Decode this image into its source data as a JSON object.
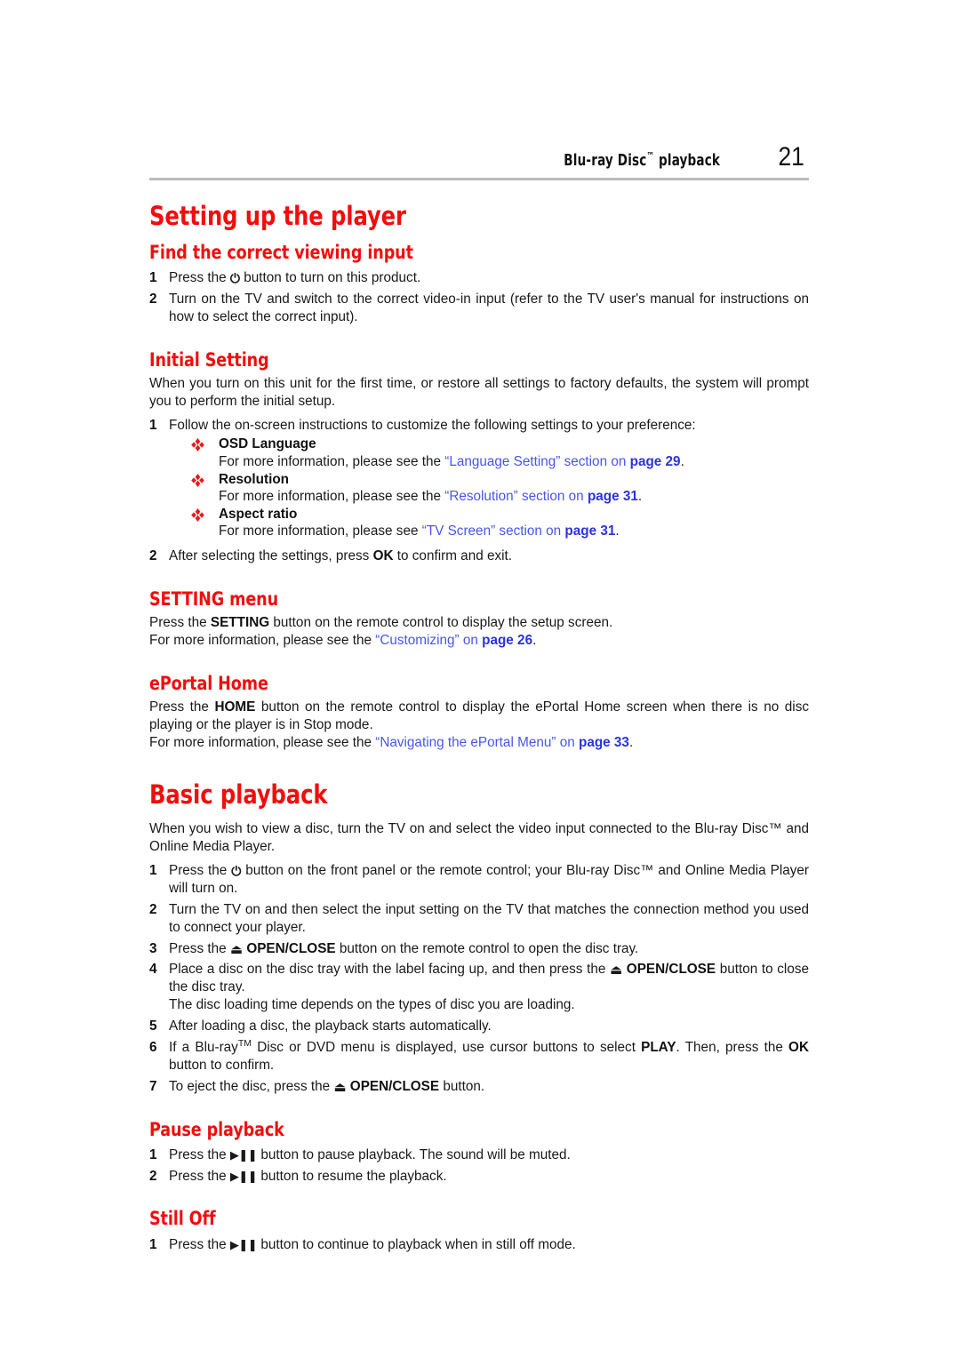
{
  "header": {
    "title_text": "Blu-ray Disc",
    "title_tm": "™",
    "title_suffix": " playback",
    "page_number": "21"
  },
  "icons": {
    "power": "⏻",
    "eject": "⏏",
    "play_pause": "▶❚❚",
    "diamond_bullet": "❖"
  },
  "colors": {
    "heading_red": "#F20D0D",
    "link_blue": "#4A55EE",
    "link_bold_blue": "#2B33E0",
    "rule_gray": "#BCBCBC"
  },
  "sections": {
    "setting_up": {
      "heading": "Setting up the player",
      "find_input": {
        "heading": "Find the correct viewing input",
        "steps": [
          {
            "num": "1",
            "pre": "Press the ",
            "icon": "power",
            "post": " button to turn on this product."
          },
          {
            "num": "2",
            "text": "Turn on the TV and switch to the correct video-in input (refer to the TV user's manual for instructions on how to select the correct input)."
          }
        ]
      },
      "initial_setting": {
        "heading": "Initial Setting",
        "intro": "When you turn on this unit for the first time, or restore all settings to factory defaults, the system will prompt you to perform the initial setup.",
        "step1_num": "1",
        "step1_text": "Follow the on-screen instructions to customize the following settings to your preference:",
        "bullets": [
          {
            "title": "OSD Language",
            "desc_pre": "For more information, please see the ",
            "link_quoted": "“Language Setting” section on ",
            "link_page": "page 29",
            "desc_post": "."
          },
          {
            "title": "Resolution",
            "desc_pre": "For more information, please see the ",
            "link_quoted": "“Resolution” section on ",
            "link_page": "page 31",
            "desc_post": "."
          },
          {
            "title": "Aspect ratio",
            "desc_pre": "For more information, please see ",
            "link_quoted": "“TV Screen” section on ",
            "link_page": "page 31",
            "desc_post": "."
          }
        ],
        "step2_num": "2",
        "step2_pre": "After selecting the settings, press ",
        "step2_bold": "OK",
        "step2_post": " to confirm and exit."
      },
      "setting_menu": {
        "heading": "SETTING menu",
        "line1_pre": "Press the ",
        "line1_bold": "SETTING",
        "line1_post": " button on the remote control to display the setup screen.",
        "line2_pre": "For more information, please see the ",
        "line2_link": "“Customizing” on ",
        "line2_page": "page 26",
        "line2_post": "."
      },
      "eportal_home": {
        "heading": "ePortal Home",
        "line1_pre": "Press the ",
        "line1_bold": "HOME",
        "line1_post": " button on the remote control to display the ePortal Home screen when there is no disc playing or the player is in Stop mode.",
        "line2_pre": "For more information, please see the ",
        "line2_link": "“Navigating the ePortal Menu” on ",
        "line2_page": "page 33",
        "line2_post": "."
      }
    },
    "basic_playback": {
      "heading": "Basic playback",
      "intro": "When you wish to view a disc, turn the TV on and select the video input connected to the Blu-ray Disc™ and Online Media Player.",
      "steps": [
        {
          "num": "1",
          "pre": "Press the ",
          "icon": "power",
          "post": " button on the front panel or the remote control; your Blu-ray Disc™ and Online Media Player will turn on."
        },
        {
          "num": "2",
          "text": "Turn the TV on and then select the input setting on the TV that matches the connection method you used to connect your player."
        },
        {
          "num": "3",
          "pre": "Press the ",
          "icon": "eject",
          "bold": "OPEN/CLOSE",
          "post": " button on the remote control to open the disc tray."
        },
        {
          "num": "4",
          "pre": "Place a disc on the disc tray with the label facing up, and then press the ",
          "icon": "eject",
          "bold": "OPEN/CLOSE",
          "post": " button to close the disc tray.",
          "extra_line": "The disc loading time depends on the types of disc you are loading."
        },
        {
          "num": "5",
          "text": "After loading a disc, the playback starts automatically."
        },
        {
          "num": "6",
          "pre": "If a Blu-ray",
          "tm": "TM",
          "mid": " Disc or DVD menu is displayed, use cursor buttons to select ",
          "bold": "PLAY",
          "mid2": ". Then, press the ",
          "bold2": "OK",
          "post": " button to confirm."
        },
        {
          "num": "7",
          "pre": "To eject the disc, press the ",
          "icon": "eject",
          "bold": "OPEN/CLOSE",
          "post": " button."
        }
      ]
    },
    "pause_playback": {
      "heading": "Pause playback",
      "steps": [
        {
          "num": "1",
          "pre": "Press the ",
          "icon": "play_pause",
          "post": " button to pause playback. The sound will be muted."
        },
        {
          "num": "2",
          "pre": "Press the ",
          "icon": "play_pause",
          "post": " button to resume the playback."
        }
      ]
    },
    "still_off": {
      "heading": "Still Off",
      "steps": [
        {
          "num": "1",
          "pre": "Press the ",
          "icon": "play_pause",
          "post": " button to continue to playback when in still off mode."
        }
      ]
    }
  }
}
